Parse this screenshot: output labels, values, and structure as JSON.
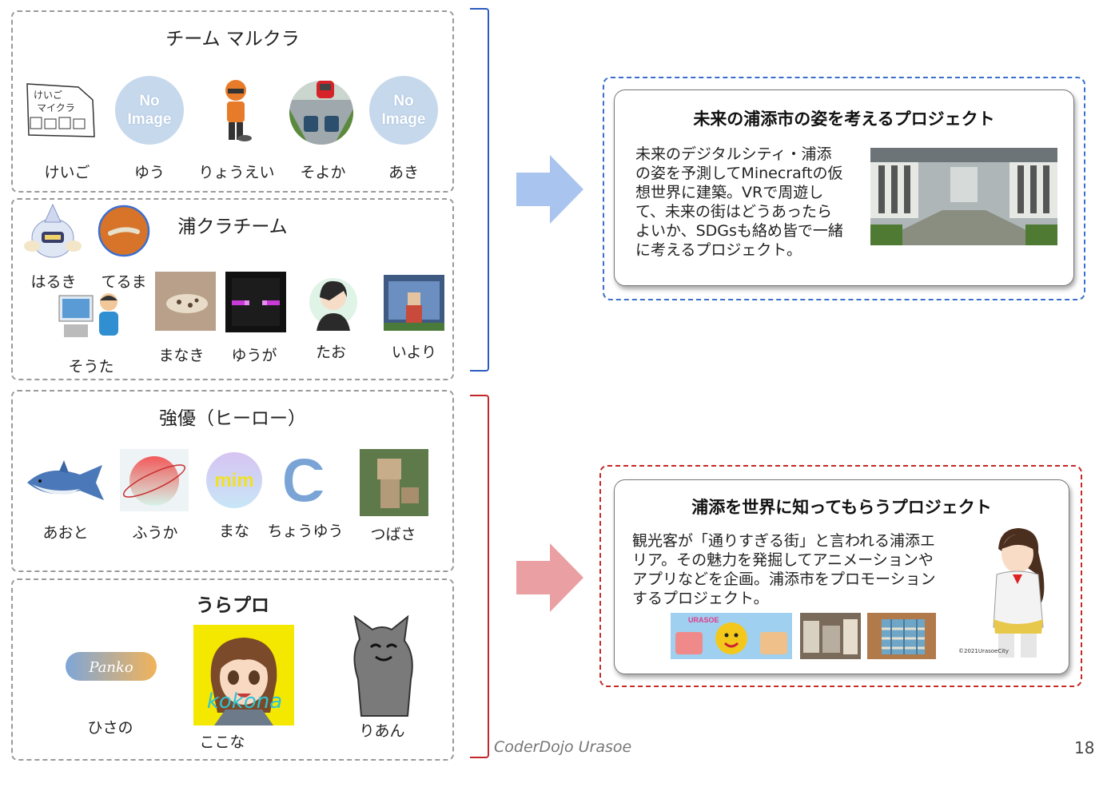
{
  "teams": [
    {
      "title": "チーム マルクラ",
      "members": [
        "けいご",
        "ゆう",
        "りょうえい",
        "そよか",
        "あき"
      ],
      "drawing_lines": [
        "けいご",
        "マイクラ"
      ],
      "noimage_lines": [
        "No",
        "Image"
      ]
    },
    {
      "title": "浦クラチーム",
      "members": [
        "はるき",
        "てるま",
        "そうた",
        "まなき",
        "ゆうが",
        "たお",
        "いより"
      ]
    },
    {
      "title": "強優（ヒーロー）",
      "members": [
        "あおと",
        "ふうか",
        "まな",
        "ちょうゆう",
        "つばさ"
      ],
      "logo_texts": [
        "mim"
      ]
    },
    {
      "title": "うらプロ",
      "members": [
        "ひさの",
        "ここな",
        "りあん"
      ],
      "logo_texts": [
        "Panko",
        "kokona"
      ]
    }
  ],
  "projects": [
    {
      "title": "未来の浦添市の姿を考えるプロジェクト",
      "description": [
        "未来のデジタルシティ・浦添",
        "の姿を予測してMinecraftの仮",
        "想世界に建築。VRで周遊し",
        "て、未来の街はどうあったら",
        "よいか、SDGsも絡め皆で一緒",
        "に考えるプロジェクト。"
      ],
      "accent_color": "#3a6fd0"
    },
    {
      "title": "浦添を世界に知ってもらうプロジェクト",
      "description": [
        "観光客が「通りすぎる街」と言われる浦添エ",
        "リア。その魅力を発掘してアニメーションや",
        "アプリなどを企画。浦添市をプロモーション",
        "するプロジェクト。"
      ],
      "image_texts": [
        "URASOE"
      ],
      "copyright": "©2021UrasoeCity",
      "accent_color": "#c42a2a"
    }
  ],
  "arrows": {
    "top_color": "#a9c4ef",
    "bottom_color": "#eaa0a3"
  },
  "footer": {
    "brand": "CoderDojo Urasoe",
    "page": "18"
  }
}
